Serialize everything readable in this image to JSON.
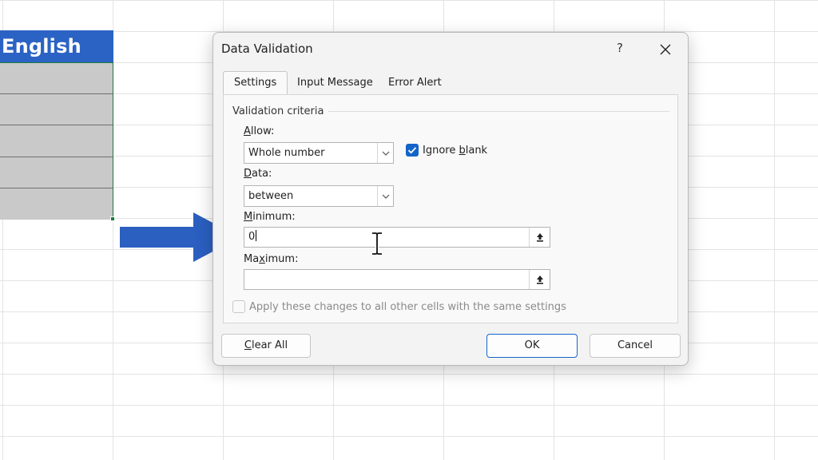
{
  "sheet": {
    "header_text": "English"
  },
  "dialog": {
    "title": "Data Validation",
    "help_label": "?",
    "tabs": [
      {
        "label": "Settings",
        "active": true
      },
      {
        "label": "Input Message",
        "active": false
      },
      {
        "label": "Error Alert",
        "active": false
      }
    ],
    "group_label": "Validation criteria",
    "allow": {
      "label_prefix": "",
      "label_hotkey": "A",
      "label_rest": "llow:",
      "value": "Whole number"
    },
    "ignore_blank": {
      "label_prefix": "Ignore ",
      "label_hotkey": "b",
      "label_rest": "lank",
      "checked": true
    },
    "data": {
      "label_prefix": "",
      "label_hotkey": "D",
      "label_rest": "ata:",
      "value": "between"
    },
    "minimum": {
      "label_prefix": "",
      "label_hotkey": "M",
      "label_rest": "inimum:",
      "value": "0"
    },
    "maximum": {
      "label_prefix": "Ma",
      "label_hotkey": "x",
      "label_rest": "imum:",
      "value": ""
    },
    "apply_all": {
      "label": "Apply these changes to all other cells with the same settings",
      "checked": false
    },
    "buttons": {
      "clear_all_hotkey": "C",
      "clear_all_rest": "lear All",
      "ok": "OK",
      "cancel": "Cancel"
    }
  },
  "colors": {
    "header_fill": "#2b63c4",
    "arrow": "#2b5fc0",
    "checkbox_accent": "#1464c8",
    "selected_cells": "#c9c9c9"
  },
  "icons": [
    "arrow-right-icon",
    "close-icon",
    "chevron-down-icon",
    "range-select-icon",
    "text-cursor-icon",
    "checkmark-icon"
  ]
}
